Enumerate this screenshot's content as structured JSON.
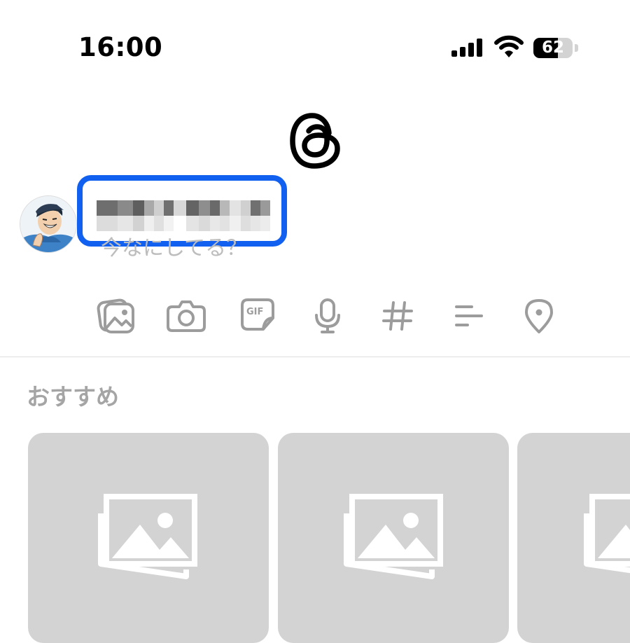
{
  "status_bar": {
    "time": "16:00",
    "battery_level": "62",
    "battery_fraction": 0.62,
    "icons": [
      "cellular-signal-icon",
      "wifi-icon",
      "battery-icon"
    ]
  },
  "header": {
    "logo": "threads-logo-icon"
  },
  "composer": {
    "username_redacted": true,
    "highlight_color": "#1160f0",
    "placeholder": "今なにしてる？",
    "tools": [
      {
        "name": "gallery-icon"
      },
      {
        "name": "camera-icon"
      },
      {
        "name": "gif-icon",
        "glyph_text": "GIF"
      },
      {
        "name": "microphone-icon"
      },
      {
        "name": "hashtag-icon"
      },
      {
        "name": "poll-icon"
      },
      {
        "name": "location-pin-icon"
      }
    ]
  },
  "recommendations": {
    "title": "おすすめ",
    "cards": [
      {
        "icon": "photo-placeholder-icon"
      },
      {
        "icon": "photo-placeholder-icon"
      },
      {
        "icon": "photo-placeholder-icon"
      }
    ]
  },
  "colors": {
    "placeholder_card": "#d3d3d3",
    "icon_gray": "#9c9c9c",
    "text_gray": "#a5a5a5"
  }
}
